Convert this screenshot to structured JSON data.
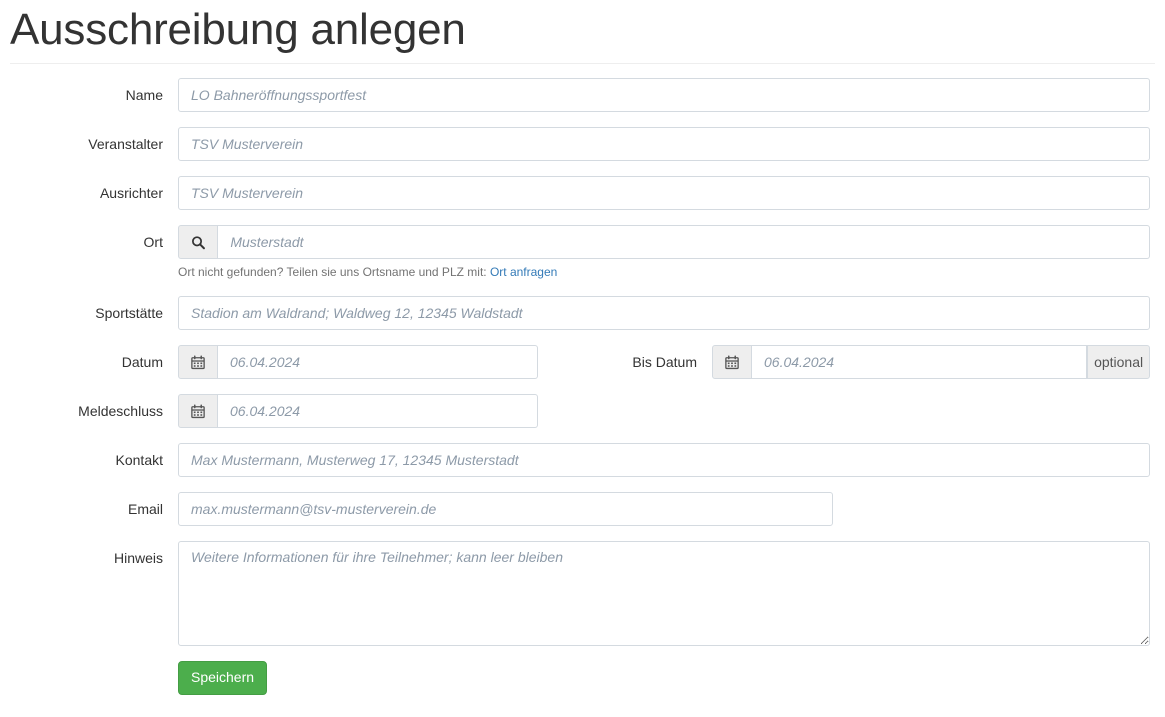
{
  "page": {
    "title": "Ausschreibung anlegen"
  },
  "colors": {
    "link": "#337ab7",
    "button_success": "#4cae4c",
    "button_success_border": "#449d44",
    "label_text": "#333333",
    "placeholder_text": "#8d9aa8",
    "input_border": "#d4dae0",
    "addon_background": "#eeeeee",
    "help_text": "#737373"
  },
  "form": {
    "fields": {
      "name": {
        "label": "Name",
        "placeholder": "LO Bahneröffnungssportfest",
        "value": ""
      },
      "veranstalter": {
        "label": "Veranstalter",
        "placeholder": "TSV Musterverein",
        "value": ""
      },
      "ausrichter": {
        "label": "Ausrichter",
        "placeholder": "TSV Musterverein",
        "value": ""
      },
      "ort": {
        "label": "Ort",
        "placeholder": "Musterstadt",
        "value": "",
        "icon": "search-icon",
        "help_text": "Ort nicht gefunden? Teilen sie uns Ortsname und PLZ mit:",
        "help_link": "Ort anfragen"
      },
      "sportstaette": {
        "label": "Sportstätte",
        "placeholder": "Stadion am Waldrand; Waldweg 12, 12345 Waldstadt",
        "value": ""
      },
      "datum": {
        "label": "Datum",
        "placeholder": "06.04.2024",
        "value": "",
        "icon": "calendar-icon"
      },
      "bis_datum": {
        "label": "Bis Datum",
        "placeholder": "06.04.2024",
        "value": "",
        "icon": "calendar-icon",
        "suffix": "optional"
      },
      "meldeschluss": {
        "label": "Meldeschluss",
        "placeholder": "06.04.2024",
        "value": "",
        "icon": "calendar-icon"
      },
      "kontakt": {
        "label": "Kontakt",
        "placeholder": "Max Mustermann, Musterweg 17, 12345 Musterstadt",
        "value": ""
      },
      "email": {
        "label": "Email",
        "placeholder": "max.mustermann@tsv-musterverein.de",
        "value": ""
      },
      "hinweis": {
        "label": "Hinweis",
        "placeholder": "Weitere Informationen für ihre Teilnehmer; kann leer bleiben",
        "value": ""
      }
    },
    "submit": {
      "label": "Speichern"
    }
  }
}
